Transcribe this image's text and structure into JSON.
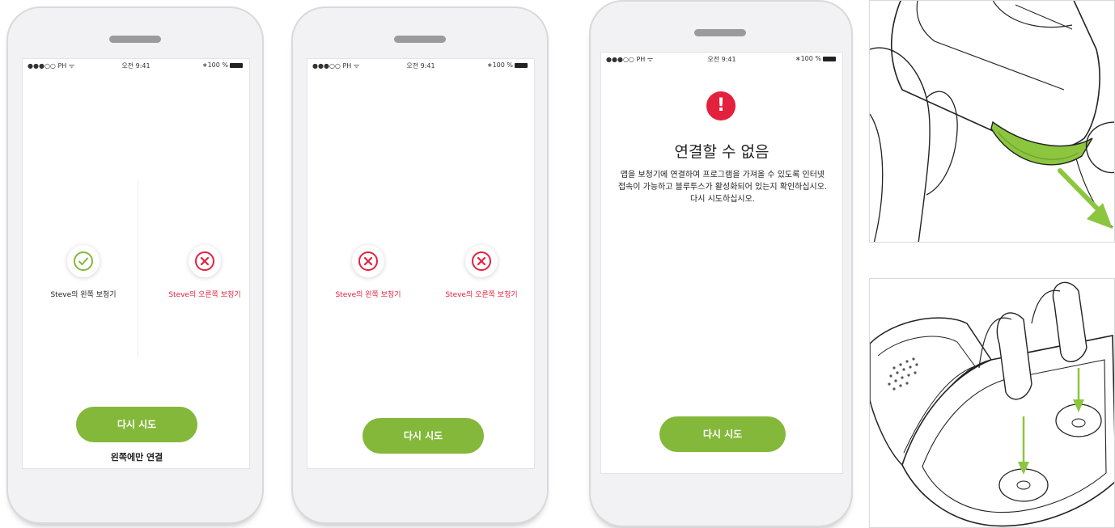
{
  "status_bar": {
    "signal": "●●●○○ PH ᯤ",
    "time": "오전 9:41",
    "battery": "∗100 %"
  },
  "screen1": {
    "left_device": {
      "label": "Steve의 왼쪽 보청기",
      "state": "connected",
      "icon": "check-icon"
    },
    "right_device": {
      "label": "Steve의 오른쪽 보청기",
      "state": "failed",
      "icon": "cross-icon"
    },
    "retry_label": "다시 시도",
    "left_only_label": "왼쪽에만 연결"
  },
  "screen2": {
    "left_device": {
      "label": "Steve의 왼쪽 보청기",
      "state": "failed",
      "icon": "cross-icon"
    },
    "right_device": {
      "label": "Steve의 오른쪽 보청기",
      "state": "failed",
      "icon": "cross-icon"
    },
    "retry_label": "다시 시도"
  },
  "screen3": {
    "alert_glyph": "!",
    "title": "연결할 수 없음",
    "message": "앱을 보청기에 연결하여 프로그램을 가져올 수 있도록 인터넷 접속이 가능하고 블루투스가 활성화되어 있는지 확인하십시오. 다시 시도하십시오.",
    "retry_label": "다시 시도"
  },
  "illustrations": {
    "top": "hearing-aid-battery-door-illustration",
    "bottom": "hearing-aid-charger-illustration"
  },
  "colors": {
    "accent": "#84b83a",
    "error": "#e3213d",
    "illustration_green": "#8cc63f"
  }
}
